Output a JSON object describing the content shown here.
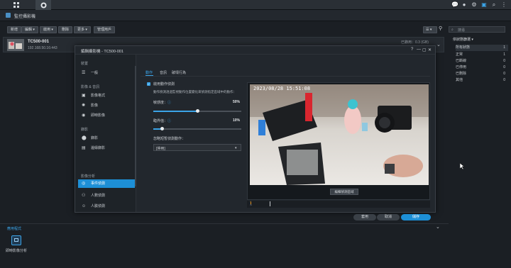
{
  "taskbar": {
    "icons": [
      "chat-icon",
      "user-icon",
      "widget-icon",
      "search-icon",
      "options-icon",
      "grid-icon"
    ]
  },
  "app": {
    "title": "監控攝影機"
  },
  "toolbar": {
    "buttons": [
      {
        "label": "新增"
      },
      {
        "label": "編輯 ▾"
      },
      {
        "label": "啟用 ▾"
      },
      {
        "label": "刪除"
      },
      {
        "label": "更多 ▾"
      },
      {
        "label": "管理用戶"
      }
    ],
    "search_placeholder": "搜尋"
  },
  "camera": {
    "name": "TC500-001",
    "address": "192.168.50.16:443",
    "status": "已錄用：0.3 (GB)",
    "status_badge": "[非錄製]"
  },
  "filter_panel": {
    "title": "依狀態篩選 ▾",
    "rows": [
      {
        "label": "所有狀態",
        "count": "1"
      },
      {
        "label": "正常",
        "count": "1"
      },
      {
        "label": "已斷線",
        "count": "0"
      },
      {
        "label": "已停用",
        "count": "0"
      },
      {
        "label": "已刪除",
        "count": "0"
      },
      {
        "label": "其他",
        "count": "0"
      }
    ]
  },
  "dialog": {
    "title": "編輯攝影機 - TC500-001",
    "controls": [
      "?",
      "—",
      "▢",
      "✕"
    ],
    "nav": {
      "sections": [
        {
          "label": "裝置",
          "items": [
            {
              "label": "一般",
              "icon": "list-icon"
            }
          ]
        },
        {
          "label": "影像 & 音訊",
          "items": [
            {
              "label": "影像格式",
              "icon": "video-icon"
            },
            {
              "label": "影像",
              "icon": "image-icon"
            },
            {
              "label": "即時影像",
              "icon": "live-icon"
            }
          ]
        },
        {
          "label": "錄影",
          "items": [
            {
              "label": "錄影",
              "icon": "record-icon"
            },
            {
              "label": "邊緣錄影",
              "icon": "edge-record-icon"
            }
          ]
        },
        {
          "label": "影像分析",
          "items": [
            {
              "label": "事件偵測",
              "icon": "event-icon",
              "active": true
            },
            {
              "label": "人數偵測",
              "icon": "people-icon"
            },
            {
              "label": "人臉偵測",
              "icon": "face-icon"
            }
          ]
        }
      ]
    },
    "tabs": [
      {
        "label": "動作",
        "active": true
      },
      {
        "label": "音訊"
      },
      {
        "label": "破壞行為"
      }
    ],
    "enable_label": "啟用動作偵測",
    "description": "動作偵測透過監視動作位置變化來偵測指定區域中的動作：",
    "sensitivity": {
      "label": "敏感度：",
      "value": "50%",
      "level": 0.5
    },
    "threshold": {
      "label": "臨界值：",
      "value": "10%",
      "level": 0.1
    },
    "ignore_label": "忽略短暫偵測動作：",
    "ignore_value": "[停用]",
    "preview": {
      "timestamp": "2023/08/28 15:51:08",
      "button": "編輯偵測區域"
    },
    "buttons": {
      "apply": "套用",
      "cancel": "取消",
      "save": "儲存"
    }
  },
  "apps_section": {
    "title": "應用程式",
    "app_label": "即時影像分析"
  }
}
